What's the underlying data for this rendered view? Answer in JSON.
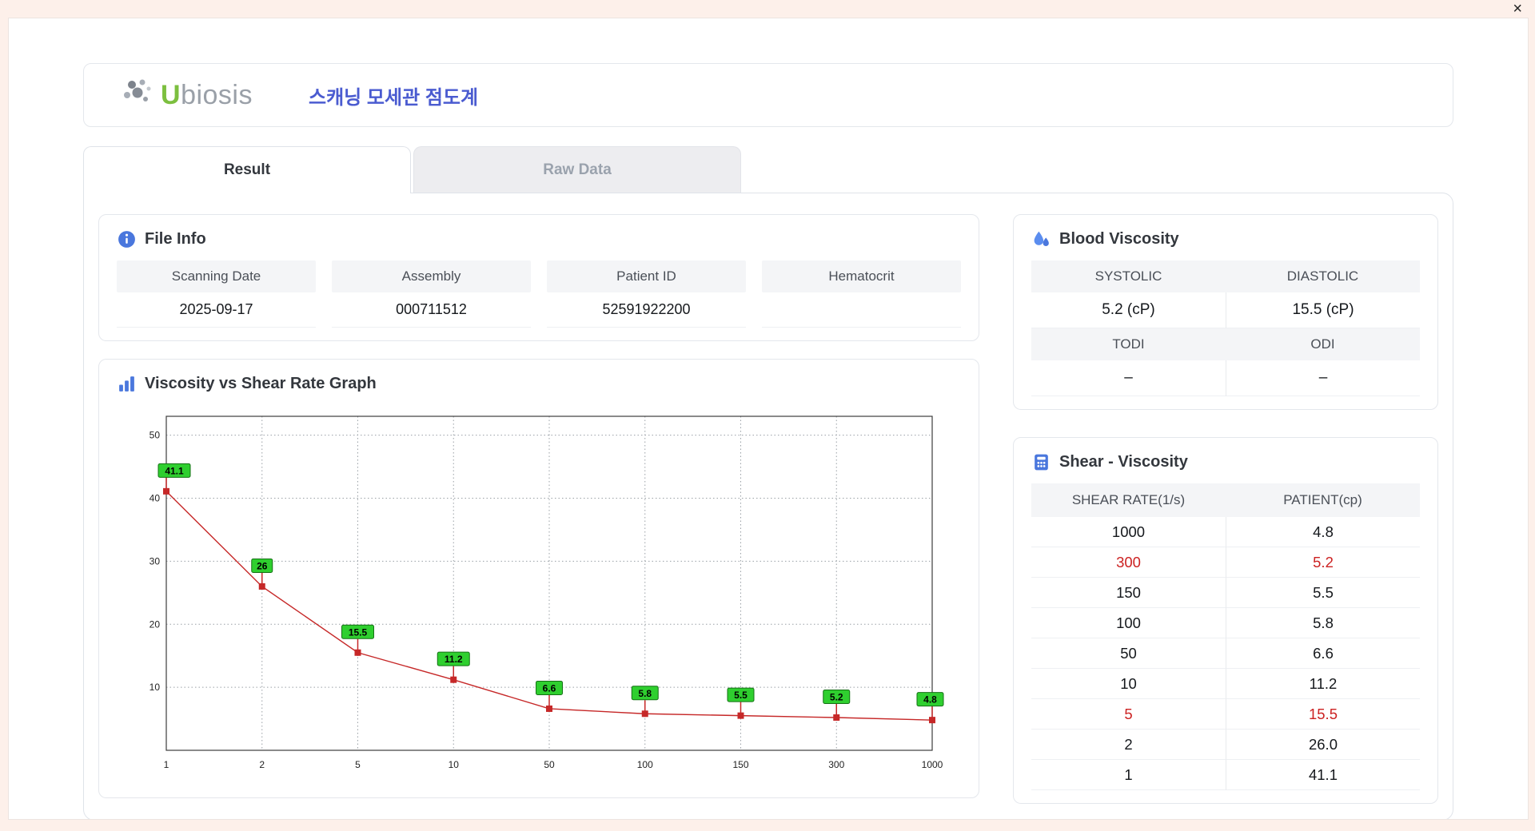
{
  "window": {
    "close_label": "×"
  },
  "header": {
    "logo_u": "U",
    "logo_rest": "biosis",
    "title": "스캐닝 모세관 점도계"
  },
  "tabs": [
    {
      "label": "Result",
      "active": true
    },
    {
      "label": "Raw Data",
      "active": false
    }
  ],
  "file_info": {
    "title": "File Info",
    "fields": [
      {
        "label": "Scanning Date",
        "value": "2025-09-17"
      },
      {
        "label": "Assembly",
        "value": "000711512"
      },
      {
        "label": "Patient ID",
        "value": "52591922200"
      },
      {
        "label": "Hematocrit",
        "value": ""
      }
    ]
  },
  "blood_viscosity": {
    "title": "Blood Viscosity",
    "header1": [
      "SYSTOLIC",
      "DIASTOLIC"
    ],
    "values1": [
      "5.2 (cP)",
      "15.5 (cP)"
    ],
    "header2": [
      "TODI",
      "ODI"
    ],
    "values2": [
      "–",
      "–"
    ]
  },
  "graph": {
    "title": "Viscosity vs Shear Rate Graph"
  },
  "chart_data": {
    "type": "line",
    "title": "Viscosity vs Shear Rate Graph",
    "x_categories": [
      "1",
      "2",
      "5",
      "10",
      "50",
      "100",
      "150",
      "300",
      "1000"
    ],
    "values": [
      41.1,
      26,
      15.5,
      11.2,
      6.6,
      5.8,
      5.5,
      5.2,
      4.8
    ],
    "point_labels": [
      "41.1",
      "26",
      "15.5",
      "11.2",
      "6.6",
      "5.8",
      "5.5",
      "5.2",
      "4.8"
    ],
    "xlabel": "",
    "ylabel": "",
    "y_ticks": [
      10,
      20,
      30,
      40,
      50
    ],
    "ylim": [
      0,
      53
    ],
    "grid": true,
    "legend": false,
    "line_color": "#c62828",
    "marker_color": "#c62828",
    "point_label_bg": "#2fcf2f"
  },
  "shear_viscosity": {
    "title": "Shear - Viscosity",
    "columns": [
      "SHEAR RATE(1/s)",
      "PATIENT(cp)"
    ],
    "rows": [
      {
        "shear": "1000",
        "patient": "4.8",
        "highlight": false
      },
      {
        "shear": "300",
        "patient": "5.2",
        "highlight": true
      },
      {
        "shear": "150",
        "patient": "5.5",
        "highlight": false
      },
      {
        "shear": "100",
        "patient": "5.8",
        "highlight": false
      },
      {
        "shear": "50",
        "patient": "6.6",
        "highlight": false
      },
      {
        "shear": "10",
        "patient": "11.2",
        "highlight": false
      },
      {
        "shear": "5",
        "patient": "15.5",
        "highlight": true
      },
      {
        "shear": "2",
        "patient": "26.0",
        "highlight": false
      },
      {
        "shear": "1",
        "patient": "41.1",
        "highlight": false
      }
    ]
  },
  "colors": {
    "accent_blue": "#4a5bd0",
    "icon_blue": "#4a77dd",
    "logo_green": "#7cbf3f",
    "logo_gray": "#9aa0a8",
    "highlight_red": "#cc2222",
    "table_header_bg": "#f4f5f7",
    "card_border": "#e4e7ec",
    "chart_line_red": "#c62828",
    "chart_label_green": "#2fcf2f"
  }
}
